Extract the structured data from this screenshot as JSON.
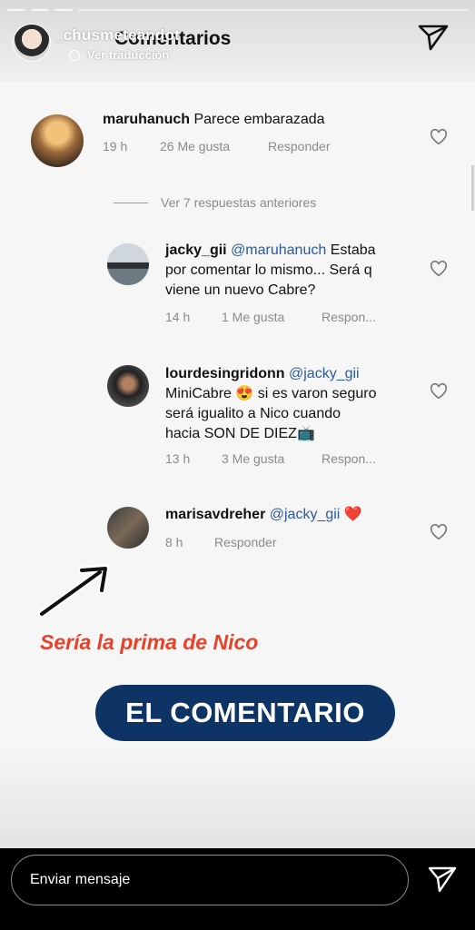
{
  "header": {
    "username_overlay": "_chusmeteandot",
    "title": "Comentarios",
    "translate": "Ver traducción",
    "progress_count": 4
  },
  "main_comment": {
    "user": "maruhanuch",
    "text": "Parece embarazada",
    "time": "19 h",
    "likes": "26 Me gusta",
    "reply": "Responder"
  },
  "view_more": "Ver 7 respuestas anteriores",
  "replies": [
    {
      "user": "jacky_gii",
      "mention": "@maruhanuch",
      "text_line1_rest": " Estaba",
      "text_line2": "por comentar lo mismo... Será q",
      "text_line3": "viene un nuevo Cabre?",
      "time": "14 h",
      "likes": "1 Me gusta",
      "reply": "Respon..."
    },
    {
      "user": "lourdesingridonn",
      "mention": "@jacky_gii",
      "text_line2_a": "MiniCabre",
      "emoji_a": "😍",
      "text_line2_b": " si es varon seguro",
      "text_line3": "será igualito a Nico cuando",
      "text_line4": "hacia SON DE DIEZ",
      "emoji_b": "📺",
      "time": "13 h",
      "likes": "3 Me gusta",
      "reply": "Respon..."
    },
    {
      "user": "marisavdreher",
      "mention": "@jacky_gii",
      "emoji": "❤️",
      "time": "8 h",
      "reply": "Responder"
    }
  ],
  "annotation": {
    "caption": "Sería la prima de Nico",
    "button": "EL COMENTARIO"
  },
  "footer": {
    "message_placeholder": "Enviar mensaje"
  },
  "colors": {
    "caption": "#e8412a",
    "button_bg": "#0e3466",
    "mention": "#2a5a9c"
  }
}
